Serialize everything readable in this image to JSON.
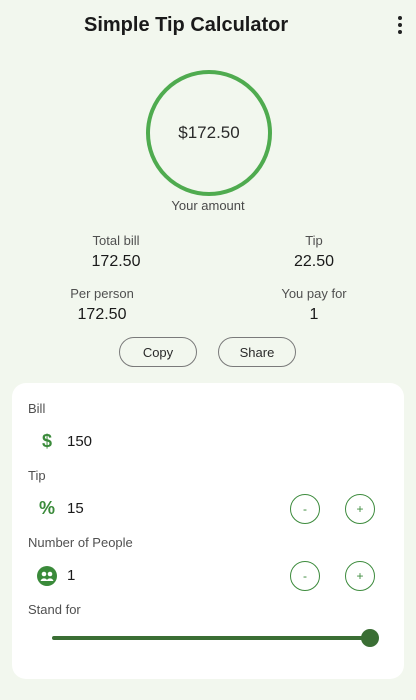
{
  "header": {
    "title": "Simple Tip Calculator",
    "menu_icon": "more-vert-icon"
  },
  "summary": {
    "amount": "$172.50",
    "amount_label": "Your amount",
    "total_bill_label": "Total bill",
    "total_bill_value": "172.50",
    "tip_label": "Tip",
    "tip_value": "22.50",
    "per_person_label": "Per person",
    "per_person_value": "172.50",
    "you_pay_label": "You pay for",
    "you_pay_value": "1"
  },
  "actions": {
    "copy_label": "Copy",
    "share_label": "Share"
  },
  "form": {
    "bill_label": "Bill",
    "bill_value": "150",
    "bill_icon": "dollar-icon",
    "tip_label": "Tip",
    "tip_value": "15",
    "tip_icon": "percent-icon",
    "people_label": "Number of People",
    "people_value": "1",
    "people_icon": "people-icon",
    "decrement_label": "-",
    "increment_label": "+",
    "stand_for_label": "Stand for",
    "stand_for_level": 1.0
  },
  "colors": {
    "accent": "#4fab4f",
    "slider": "#3a6e34",
    "background": "#f2f7ee"
  }
}
